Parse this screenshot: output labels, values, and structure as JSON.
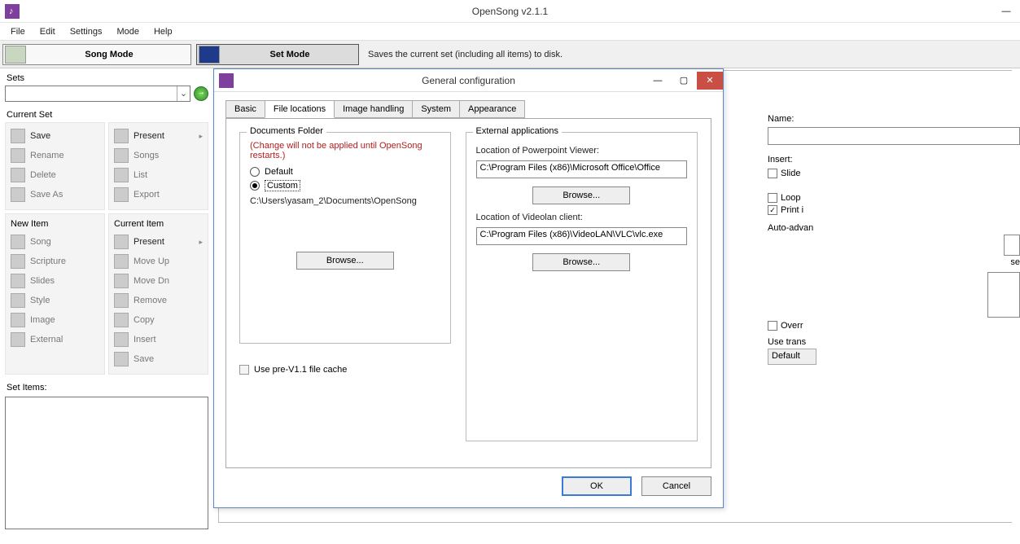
{
  "app": {
    "title": "OpenSong v2.1.1"
  },
  "menu": [
    "File",
    "Edit",
    "Settings",
    "Mode",
    "Help"
  ],
  "modes": {
    "song": "Song Mode",
    "set": "Set Mode",
    "hint": "Saves the current set (including all items) to disk."
  },
  "sets": {
    "label": "Sets"
  },
  "current_set": {
    "label": "Current Set",
    "left": [
      {
        "k": "save",
        "t": "Save",
        "a": true
      },
      {
        "k": "rename",
        "t": "Rename"
      },
      {
        "k": "delete",
        "t": "Delete"
      },
      {
        "k": "saveas",
        "t": "Save As"
      }
    ],
    "right": [
      {
        "k": "present",
        "t": "Present",
        "arr": true
      },
      {
        "k": "songs",
        "t": "Songs"
      },
      {
        "k": "list",
        "t": "List"
      },
      {
        "k": "export",
        "t": "Export"
      }
    ]
  },
  "new_item": {
    "label": "New Item",
    "items": [
      {
        "k": "song",
        "t": "Song"
      },
      {
        "k": "scripture",
        "t": "Scripture"
      },
      {
        "k": "slides",
        "t": "Slides"
      },
      {
        "k": "style",
        "t": "Style"
      },
      {
        "k": "image",
        "t": "Image"
      },
      {
        "k": "external",
        "t": "External"
      }
    ]
  },
  "current_item": {
    "label": "Current Item",
    "items": [
      {
        "k": "present",
        "t": "Present",
        "arr": true,
        "a": true
      },
      {
        "k": "moveup",
        "t": "Move Up"
      },
      {
        "k": "movedn",
        "t": "Move Dn"
      },
      {
        "k": "remove",
        "t": "Remove"
      },
      {
        "k": "copy",
        "t": "Copy"
      },
      {
        "k": "insert",
        "t": "Insert"
      },
      {
        "k": "save",
        "t": "Save"
      }
    ]
  },
  "set_items": {
    "label": "Set Items:"
  },
  "right": {
    "name_label": "Name:",
    "insert_label": "Insert:",
    "slide": "Slide",
    "loop": "Loop",
    "print": "Print i",
    "auto": "Auto-advan",
    "sec": "se",
    "overr": "Overr",
    "use_trans": "Use trans",
    "default": "Default"
  },
  "dialog": {
    "title": "General configuration",
    "tabs": [
      "Basic",
      "File locations",
      "Image handling",
      "System",
      "Appearance"
    ],
    "docs": {
      "legend": "Documents Folder",
      "warn": "(Change will not be applied until OpenSong restarts.)",
      "default": "Default",
      "custom": "Custom",
      "path": "C:\\Users\\yasam_2\\Documents\\OpenSong",
      "browse": "Browse...",
      "precache": "Use pre-V1.1 file cache"
    },
    "ext": {
      "legend": "External applications",
      "ppt_label": "Location of Powerpoint Viewer:",
      "ppt_path": "C:\\Program Files (x86)\\Microsoft Office\\Office",
      "vlc_label": "Location of Videolan client:",
      "vlc_path": "C:\\Program Files (x86)\\VideoLAN\\VLC\\vlc.exe",
      "browse": "Browse..."
    },
    "ok": "OK",
    "cancel": "Cancel"
  }
}
